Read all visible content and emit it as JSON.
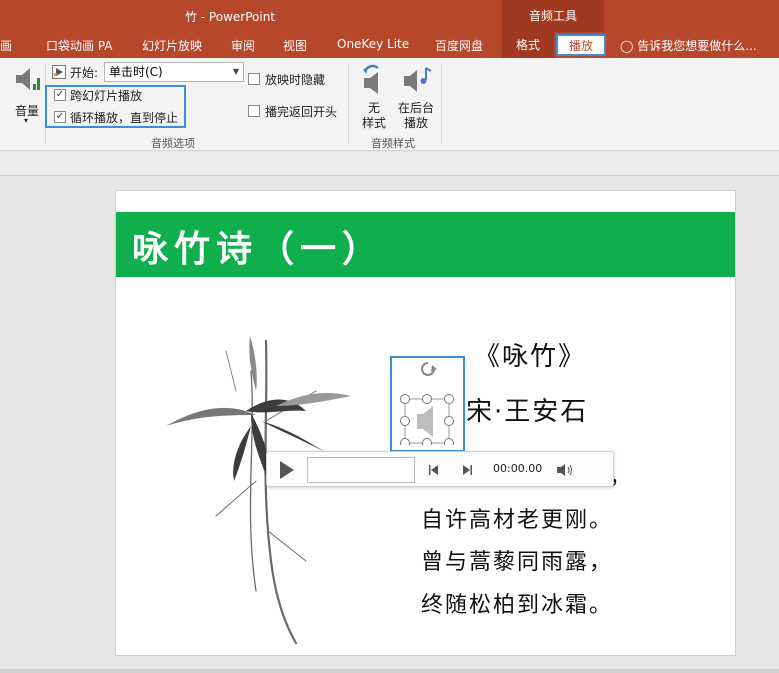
{
  "window": {
    "title": "竹 - PowerPoint",
    "tool_tab_header": "音频工具"
  },
  "tabs": [
    {
      "label": "画"
    },
    {
      "label": "口袋动画 PA"
    },
    {
      "label": "幻灯片放映"
    },
    {
      "label": "审阅"
    },
    {
      "label": "视图"
    },
    {
      "label": "OneKey Lite"
    },
    {
      "label": "百度网盘"
    },
    {
      "label": "格式"
    },
    {
      "label": "播放"
    }
  ],
  "tell_me": "告诉我您想要做什么...",
  "ribbon": {
    "volume_label": "音量",
    "start_label": "开始:",
    "start_value": "单击时(C)",
    "cross_slide": "跨幻灯片播放",
    "loop": "循环播放，直到停止",
    "hide_during_show": "放映时隐藏",
    "rewind_after": "播完返回开头",
    "options_group": "音频选项",
    "no_style_1": "无",
    "no_style_2": "样式",
    "bg_play_1": "在后台",
    "bg_play_2": "播放",
    "styles_group": "音频样式",
    "cross_slide_checked": true,
    "loop_checked": true,
    "hide_checked": false,
    "rewind_checked": false
  },
  "slide": {
    "title": "咏竹诗（一）",
    "poem_title": "《咏竹》",
    "author": "宋·王安石",
    "line1_tail": "瘦，",
    "line2": "自许高材老更刚。",
    "line3": "曾与蒿藜同雨露，",
    "line4": "终随松柏到冰霜。"
  },
  "player": {
    "time": "00:00.00"
  },
  "colors": {
    "accent": "#b7472a",
    "slide_header": "#0faf4e",
    "selection": "#3a8fd8"
  }
}
